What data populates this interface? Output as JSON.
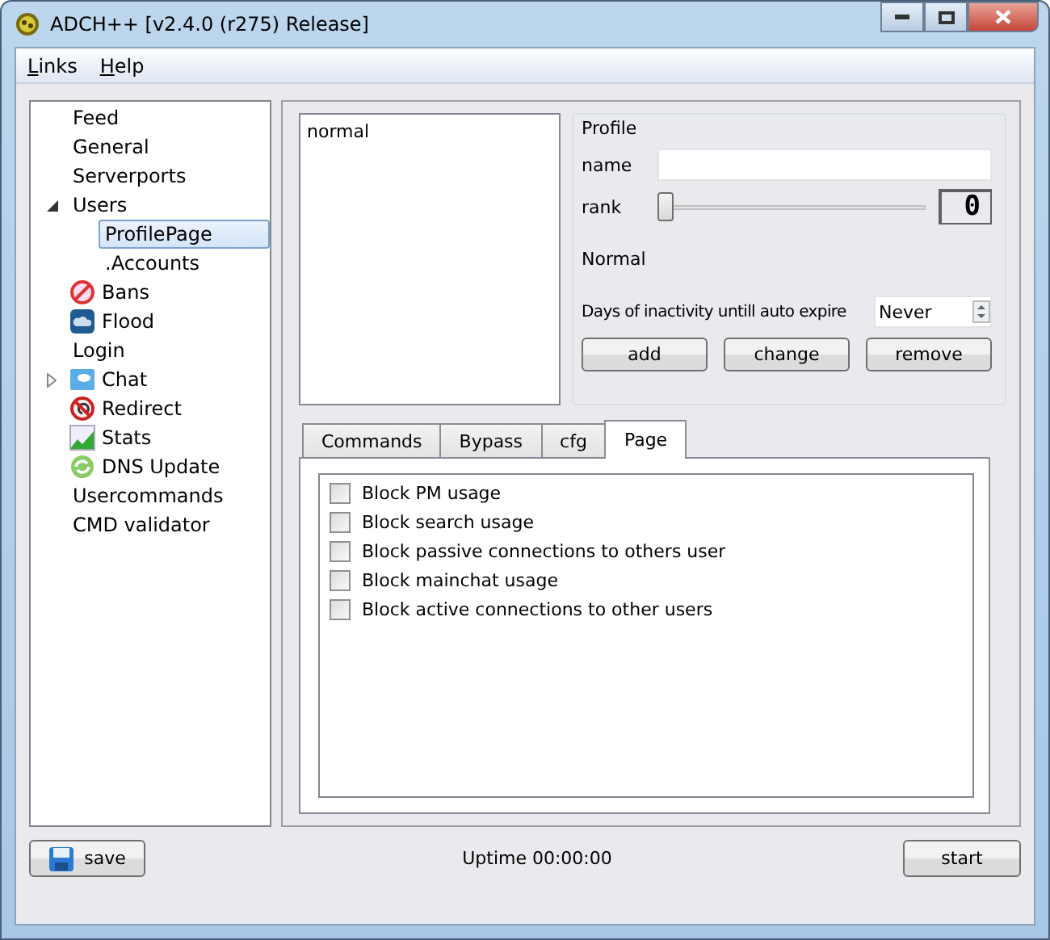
{
  "window": {
    "title": "ADCH++ [v2.4.0 (r275) Release]"
  },
  "menu": [
    {
      "label": "Links"
    },
    {
      "label": "Help"
    }
  ],
  "tree": [
    {
      "label": "Feed",
      "kind": "plain"
    },
    {
      "label": "General",
      "kind": "plain"
    },
    {
      "label": "Serverports",
      "kind": "plain"
    },
    {
      "label": "Users",
      "kind": "plain",
      "expanded": true,
      "children": [
        {
          "label": "ProfilePage",
          "selected": true
        },
        {
          "label": ".Accounts",
          "selected": false
        }
      ]
    },
    {
      "label": "Bans",
      "kind": "bans"
    },
    {
      "label": "Flood",
      "kind": "flood"
    },
    {
      "label": "Login",
      "kind": "plain"
    },
    {
      "label": "Chat",
      "kind": "chat",
      "expanded": false
    },
    {
      "label": "Redirect",
      "kind": "redirect"
    },
    {
      "label": "Stats",
      "kind": "stats"
    },
    {
      "label": "DNS Update",
      "kind": "dns"
    },
    {
      "label": "Usercommands",
      "kind": "plain"
    },
    {
      "label": "CMD validator",
      "kind": "plain"
    }
  ],
  "profiles": [
    "normal"
  ],
  "profile": {
    "title": "Profile",
    "name_label": "name",
    "rank_label": "rank",
    "rank": {
      "level": 0
    },
    "rank_display": "0",
    "rank_name": "Normal",
    "expire_label": "Days of inactivity untill auto expire",
    "expire_value": "Never",
    "buttons": [
      "add",
      "change",
      "remove"
    ]
  },
  "tabs": [
    {
      "label": "Commands",
      "selected": false
    },
    {
      "label": "Bypass",
      "selected": false
    },
    {
      "label": "cfg",
      "selected": false
    },
    {
      "label": "Page",
      "selected": true
    }
  ],
  "options": [
    {
      "label": "Block PM usage",
      "checked": false
    },
    {
      "label": "Block search usage",
      "checked": false
    },
    {
      "label": "Block passive connections to others user",
      "checked": false
    },
    {
      "label": "Block mainchat usage",
      "checked": false
    },
    {
      "label": "Block active connections to other users",
      "checked": false
    }
  ],
  "footer": {
    "save": "save",
    "uptime": "Uptime 00:00:00",
    "start": "start"
  }
}
